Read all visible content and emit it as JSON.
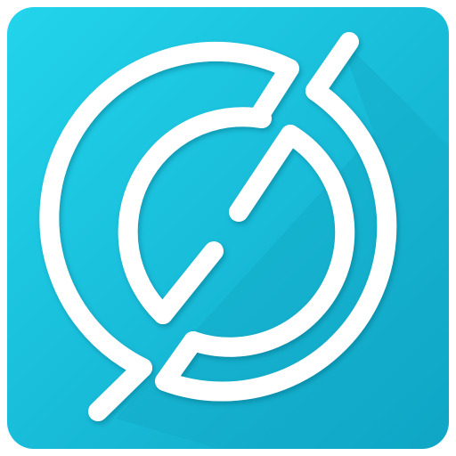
{
  "icon": {
    "name": "app-icon",
    "glyph": "slashed-circle-logo",
    "colors": {
      "tile_top": "#22d4ec",
      "tile_bottom": "#0fa6c6",
      "glyph": "#ffffff",
      "long_shadow": "#0b8aa6"
    }
  }
}
